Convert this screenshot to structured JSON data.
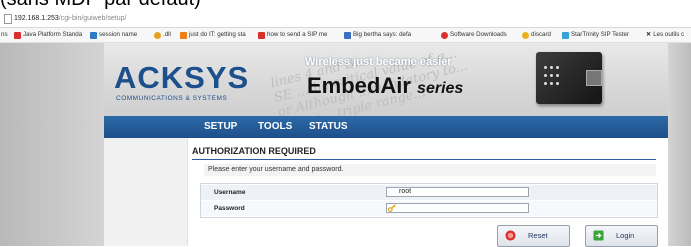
{
  "caption": "(sans MDP  par défaut)",
  "address": {
    "host": "192.168.1.253",
    "path": "/cgi-bin/guiweb/setup/"
  },
  "bookmarks": [
    {
      "label": "ns",
      "color": "#ffffff"
    },
    {
      "label": "Java Platform Standa",
      "color": "#d9302c"
    },
    {
      "label": "session name",
      "color": "#2e7ac4"
    },
    {
      "label": ".dll",
      "color": "#e3a21a"
    },
    {
      "label": "just do IT: getting sta",
      "color": "#f07c12"
    },
    {
      "label": "how to send a SIP me",
      "color": "#d9302c"
    },
    {
      "label": "Big bertha says: defa",
      "color": "#3a6fc4"
    },
    {
      "label": "Software Downloads",
      "color": "#d9302c"
    },
    {
      "label": "discard",
      "color": "#e8b11c"
    },
    {
      "label": "StarTrinity SIP Tester",
      "color": "#3aa0d8"
    },
    {
      "label": "Les outils c",
      "color": "#222222"
    }
  ],
  "banner": {
    "logo": "ACKSYS",
    "logo_sub": "COMMUNICATIONS & SYSTEMS",
    "tagline": "Wireless just became easier",
    "product": "EmbedAir",
    "series": "series",
    "script": "lines 4 and B...\nSE ...the critical value of g...\nor Although ...mandatory to...\nplying ...triple range...\n...seas betwe..."
  },
  "nav": [
    {
      "label": "SETUP"
    },
    {
      "label": "TOOLS"
    },
    {
      "label": "STATUS"
    }
  ],
  "auth": {
    "title": "AUTHORIZATION REQUIRED",
    "instruction": "Please enter your username and password.",
    "username_label": "Username",
    "username_value": "root",
    "password_label": "Password",
    "password_value": ""
  },
  "buttons": {
    "reset": "Reset",
    "login": "Login"
  },
  "colors": {
    "brand_blue": "#1d4f8c",
    "nav": "#2a64a3",
    "reset_icon": "#d9302c",
    "login_icon": "#3aa33a"
  }
}
